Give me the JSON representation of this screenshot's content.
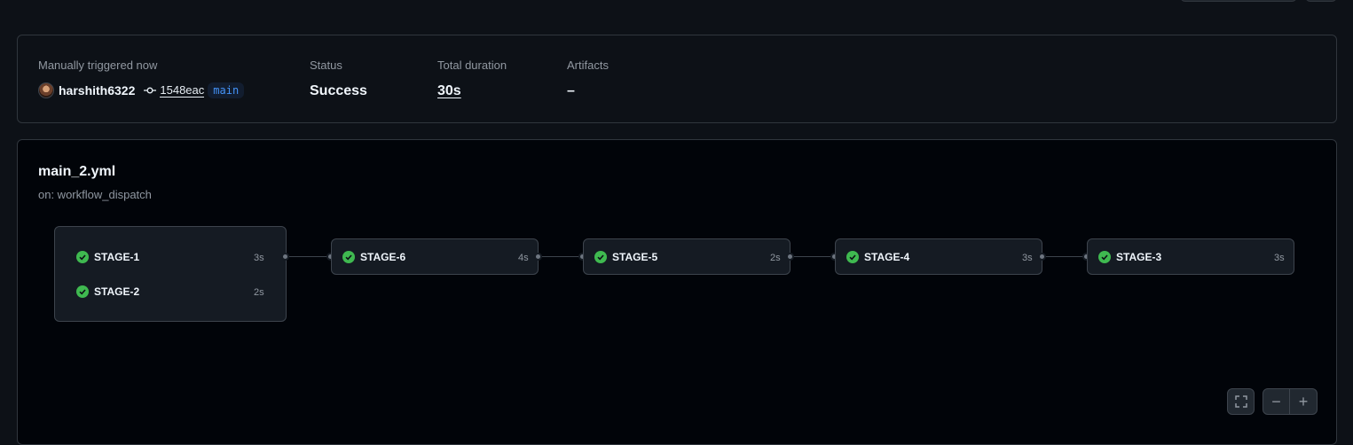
{
  "summary": {
    "trigger_label": "Manually triggered now",
    "actor": "harshith6322",
    "commit_sha": "1548eac",
    "branch": "main",
    "status_label": "Status",
    "status_value": "Success",
    "duration_label": "Total duration",
    "duration_value": "30s",
    "artifacts_label": "Artifacts",
    "artifacts_value": "–"
  },
  "workflow": {
    "file": "main_2.yml",
    "trigger": "on: workflow_dispatch"
  },
  "jobs": [
    {
      "name": "STAGE-1",
      "duration": "3s",
      "status": "success"
    },
    {
      "name": "STAGE-2",
      "duration": "2s",
      "status": "success"
    },
    {
      "name": "STAGE-6",
      "duration": "4s",
      "status": "success"
    },
    {
      "name": "STAGE-5",
      "duration": "2s",
      "status": "success"
    },
    {
      "name": "STAGE-4",
      "duration": "3s",
      "status": "success"
    },
    {
      "name": "STAGE-3",
      "duration": "3s",
      "status": "success"
    }
  ],
  "controls": {
    "zoom_out": "−",
    "zoom_in": "+"
  },
  "colors": {
    "success": "#3fb950",
    "link": "#4493f8"
  }
}
